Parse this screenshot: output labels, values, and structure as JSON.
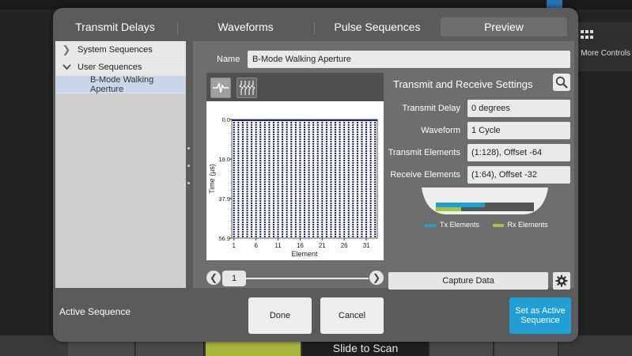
{
  "background": {
    "more_controls_label": "More Controls",
    "slide_to_scan": "Slide to Scan"
  },
  "tabs": [
    {
      "label": "Transmit Delays"
    },
    {
      "label": "Waveforms"
    },
    {
      "label": "Pulse Sequences"
    },
    {
      "label": "Preview",
      "active": true
    }
  ],
  "tree": {
    "items": [
      {
        "label": "System Sequences",
        "icon": "chevron-right-icon"
      },
      {
        "label": "User Sequences",
        "icon": "chevron-down-icon"
      },
      {
        "label": "B-Mode Walking Aperture",
        "selected": true
      }
    ]
  },
  "name": {
    "label": "Name",
    "value": "B-Mode Walking Aperture"
  },
  "settings": {
    "title": "Transmit and Receive Settings",
    "rows": [
      {
        "label": "Transmit Delay",
        "value": "0 degrees"
      },
      {
        "label": "Waveform",
        "value": "1 Cycle"
      },
      {
        "label": "Transmit Elements",
        "value": "(1:128), Offset -64"
      },
      {
        "label": "Receive Elements",
        "value": "(1:64), Offset -32"
      }
    ]
  },
  "legend": {
    "tx_label": "Tx Elements",
    "rx_label": "Rx Elements",
    "tx_color": "#1e9ed6",
    "rx_color": "#a7c33a"
  },
  "slider": {
    "value": "1"
  },
  "buttons": {
    "capture": "Capture Data",
    "done": "Done",
    "cancel": "Cancel",
    "set_active": "Set as Active Sequence"
  },
  "footer": {
    "active_sequence_label": "Active Sequence"
  },
  "chart_data": {
    "type": "line",
    "xlabel": "Element",
    "ylabel": "Time (µs)",
    "x_ticks": [
      "1",
      "6",
      "11",
      "16",
      "21",
      "26",
      "31"
    ],
    "y_ticks": [
      "0.0",
      "19.0",
      "37.9",
      "56.9"
    ],
    "xlim": [
      0,
      33
    ],
    "ylim": [
      0,
      56.9
    ],
    "y_inverted": true,
    "series_color": "#1a1a8c",
    "element_count": 33
  }
}
